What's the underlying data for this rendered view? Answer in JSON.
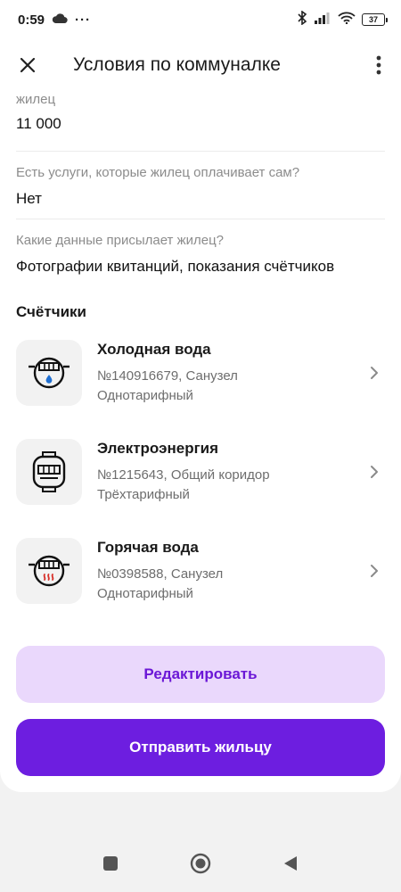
{
  "status_bar": {
    "time": "0:59",
    "dots": "···",
    "battery": "37"
  },
  "header": {
    "title": "Условия по коммуналке"
  },
  "fields": [
    {
      "label": "жилец",
      "value": "11 000"
    },
    {
      "label": "Есть услуги, которые жилец оплачивает сам?",
      "value": "Нет"
    },
    {
      "label": "Какие данные присылает жилец?",
      "value": "Фотографии квитанций, показания счётчиков"
    }
  ],
  "meters_section": {
    "title": "Счётчики",
    "items": [
      {
        "name": "Холодная вода",
        "number": "№140916679, Санузел",
        "tariff": "Однотарифный",
        "icon": "cold-water-meter-icon"
      },
      {
        "name": "Электроэнергия",
        "number": "№1215643, Общий коридор",
        "tariff": "Трёхтарифный",
        "icon": "electricity-meter-icon"
      },
      {
        "name": "Горячая вода",
        "number": "№0398588, Санузел",
        "tariff": "Однотарифный",
        "icon": "hot-water-meter-icon"
      }
    ]
  },
  "buttons": {
    "edit": "Редактировать",
    "send": "Отправить жильцу"
  },
  "colors": {
    "accent": "#6d1ee0",
    "accent_light": "#ead8fc",
    "accent_text": "#6b17d6",
    "cold_drop": "#1f6fd1",
    "hot_marks": "#d7302a"
  }
}
